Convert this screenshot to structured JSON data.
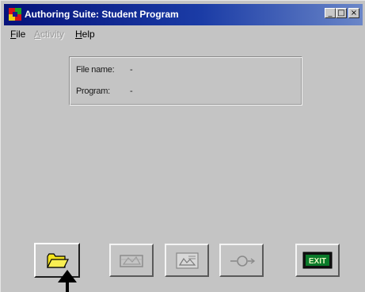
{
  "window": {
    "title": "Authoring Suite: Student Program",
    "minimize_glyph": "_",
    "maximize_glyph": "□",
    "close_glyph": "×"
  },
  "menu": {
    "items": [
      {
        "label_first": "F",
        "label_rest": "ile",
        "enabled": true
      },
      {
        "label_first": "A",
        "label_rest": "ctivity",
        "enabled": false
      },
      {
        "label_first": "H",
        "label_rest": "elp",
        "enabled": true
      }
    ]
  },
  "info": {
    "file_name_label": "File name:",
    "file_name_value": "-",
    "program_label": "Program:",
    "program_value": "-"
  },
  "toolbar": {
    "buttons": [
      {
        "name": "open-button",
        "icon": "folder-icon",
        "enabled": true
      },
      {
        "name": "program-button",
        "icon": "film-icon",
        "enabled": false
      },
      {
        "name": "slide-button",
        "icon": "picture-icon",
        "enabled": false
      },
      {
        "name": "play-button",
        "icon": "connector-icon",
        "enabled": false
      },
      {
        "name": "exit-button",
        "icon": "exit-sign-icon",
        "enabled": true,
        "label": "EXIT"
      }
    ]
  },
  "colors": {
    "face": "#c4c4c4",
    "title_start": "#05127a",
    "title_end": "#6a86c8",
    "folder": "#f4e41e",
    "exit_sign": "#0a7a2a"
  }
}
